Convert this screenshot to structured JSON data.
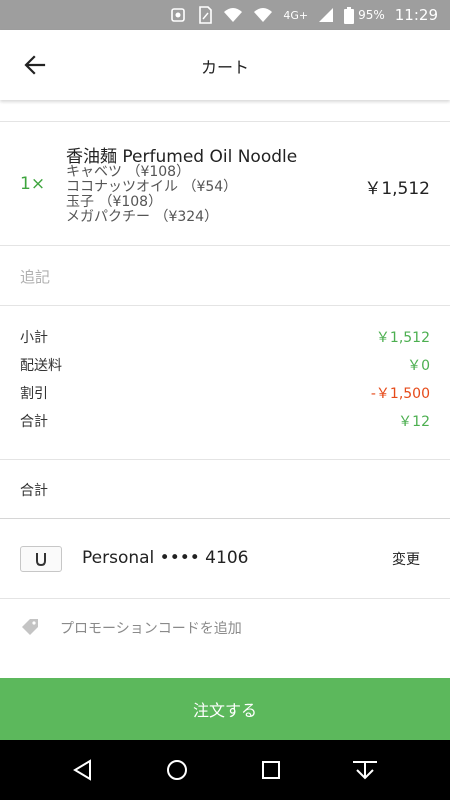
{
  "status_bar": {
    "network": "4G+",
    "battery": "95%",
    "time": "11:29"
  },
  "header": {
    "title": "カート"
  },
  "item": {
    "quantity": "1×",
    "name": "香油麺 Perfumed Oil Noodle",
    "options": [
      "キャベツ （¥108）",
      "ココナッツオイル （¥54）",
      "玉子 （¥108）",
      "メガパクチー （¥324）"
    ],
    "price": "￥1,512"
  },
  "memo": {
    "placeholder": "追記"
  },
  "summary": {
    "subtotal_label": "小計",
    "subtotal_value": "￥1,512",
    "delivery_label": "配送料",
    "delivery_value": "￥0",
    "discount_label": "割引",
    "discount_value": "-￥1,500",
    "total_label": "合計",
    "total_value": "￥12"
  },
  "total_section": {
    "label": "合計"
  },
  "payment": {
    "label": "Personal •••• 4106",
    "change": "変更"
  },
  "promo": {
    "label": "プロモーションコードを追加"
  },
  "order_button": {
    "label": "注文する"
  },
  "colors": {
    "accent_green": "#5cb85c",
    "discount_red": "#e64a19",
    "status_bar": "#9e9e9e"
  }
}
